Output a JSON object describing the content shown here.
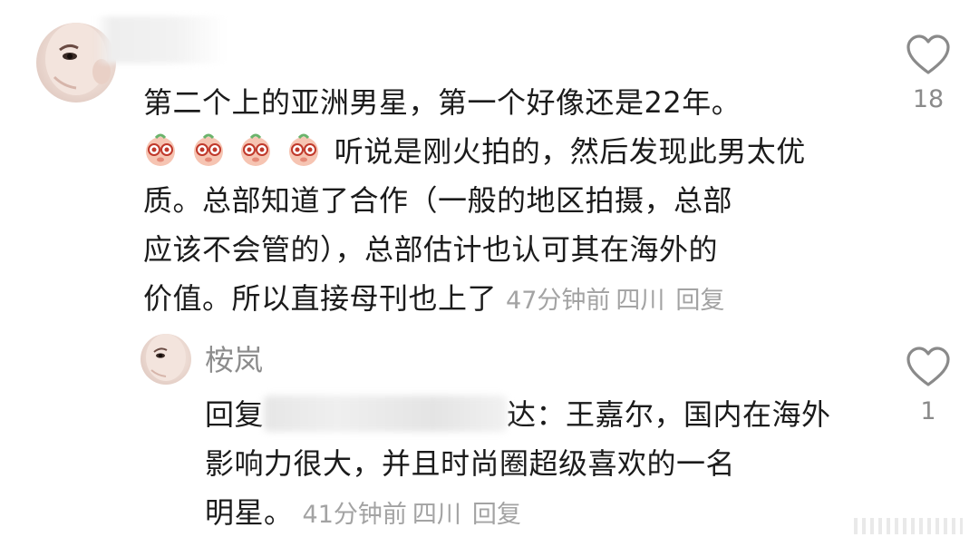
{
  "comments": [
    {
      "text_line1": "第二个上的亚洲男星，第一个好像还是22年。",
      "emoji_count": 4,
      "emoji_icon": "pig-face-emoji-icon",
      "text_line2": "听说是刚火拍的，然后发现此男太优",
      "text_line3": "质。总部知道了合作（一般的地区拍摄，总部",
      "text_line4": "应该不会管的），总部估计也认可其在海外的",
      "text_line5": "价值。所以直接母刊也上了",
      "time": "47分钟前",
      "location": "四川",
      "reply_label": "回复",
      "likes": "18"
    },
    {
      "username": "桉岚",
      "reply_prefix": "回复",
      "reply_suffix": "达：王嘉尔，国内在海外",
      "text_line2": "影响力很大，并且时尚圈超级喜欢的一名",
      "text_line3": "明星。",
      "time": "41分钟前",
      "location": "四川",
      "reply_label": "回复",
      "likes": "1"
    }
  ],
  "colors": {
    "text": "#1b1b1b",
    "meta": "#a3a3a3",
    "like_count": "#8a8a8a",
    "heart_outline": "#8a8a8a"
  }
}
